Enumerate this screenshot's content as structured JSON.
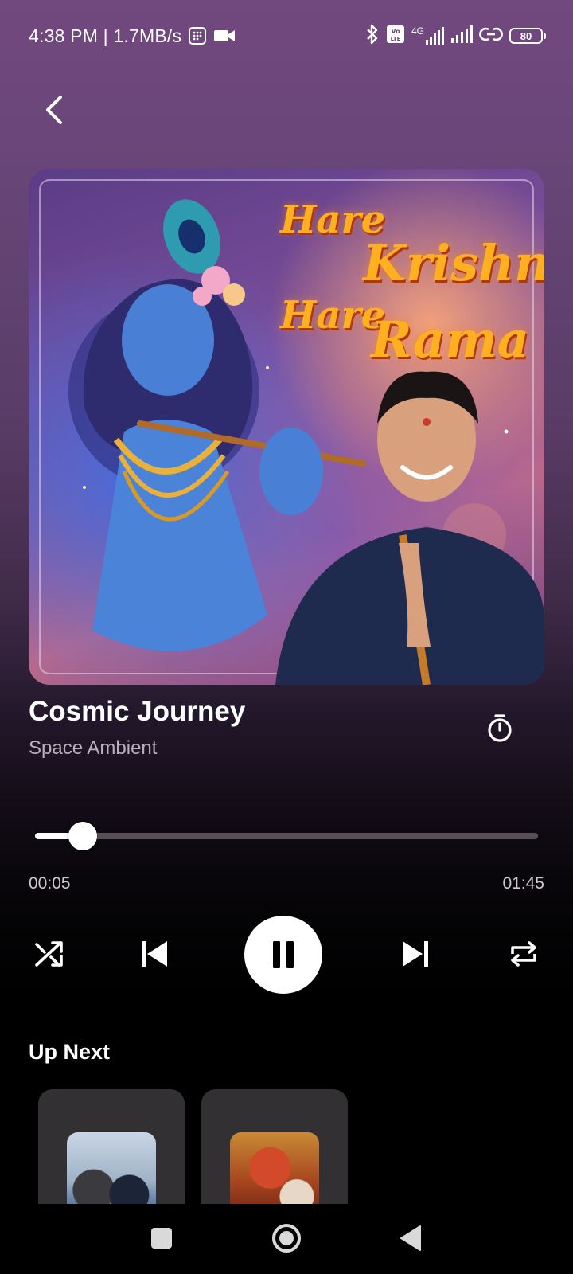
{
  "status_bar": {
    "time_speed": "4:38 PM | 1.7MB/s",
    "network_label": "4G",
    "volte_label": "Vo LTE",
    "battery_level": "80"
  },
  "album_art": {
    "text_line_1": "Hare",
    "text_line_2": "Krishna",
    "text_line_3": "Hare",
    "text_line_4": "Rama"
  },
  "track": {
    "title": "Cosmic Journey",
    "artist": "Space Ambient"
  },
  "playback": {
    "current_time": "00:05",
    "total_time": "01:45",
    "progress": 0.05,
    "state": "playing"
  },
  "up_next": {
    "heading": "Up Next",
    "items": [
      {
        "thumbnail": "devotional-singer-thumbnail"
      },
      {
        "thumbnail": "goddess-durga-thumbnail"
      }
    ]
  },
  "colors": {
    "accent": "#ffffff",
    "bg_top": "#72497f",
    "bg_bottom": "#000000",
    "card_bg": "#333033"
  },
  "icons": {
    "back": "chevron-left-icon",
    "timer": "stopwatch-icon",
    "shuffle": "shuffle-icon",
    "previous": "skip-previous-icon",
    "pause": "pause-icon",
    "next": "skip-next-icon",
    "repeat": "repeat-icon"
  }
}
